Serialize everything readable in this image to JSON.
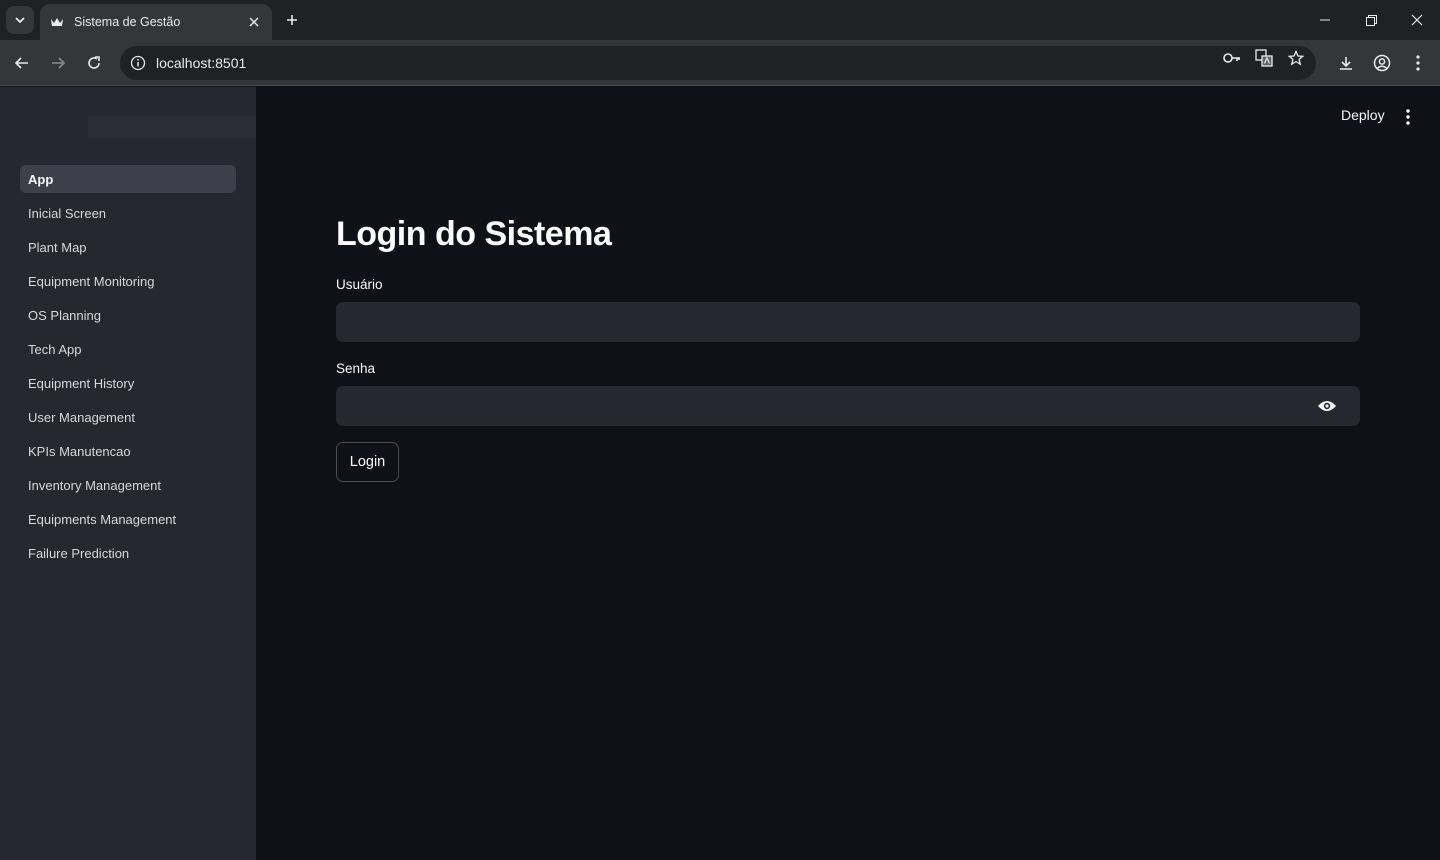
{
  "browser": {
    "tab_title": "Sistema de Gestão",
    "url": "localhost:8501"
  },
  "header": {
    "deploy_label": "Deploy"
  },
  "sidebar": {
    "items": [
      {
        "label": "App",
        "active": true
      },
      {
        "label": "Inicial Screen"
      },
      {
        "label": "Plant Map"
      },
      {
        "label": "Equipment Monitoring"
      },
      {
        "label": "OS Planning"
      },
      {
        "label": "Tech App"
      },
      {
        "label": "Equipment History"
      },
      {
        "label": "User Management"
      },
      {
        "label": "KPIs Manutencao"
      },
      {
        "label": "Inventory Management"
      },
      {
        "label": "Equipments Management"
      },
      {
        "label": "Failure Prediction"
      }
    ]
  },
  "main": {
    "title": "Login do Sistema",
    "username_label": "Usuário",
    "username_value": "",
    "password_label": "Senha",
    "password_value": "",
    "login_label": "Login"
  },
  "icons": {
    "favicon": "streamlit-crown-icon",
    "eye": "eye-icon"
  },
  "colors": {
    "background": "#0e1117",
    "sidebar": "#262730",
    "input": "#262730",
    "text": "#fafafa"
  }
}
